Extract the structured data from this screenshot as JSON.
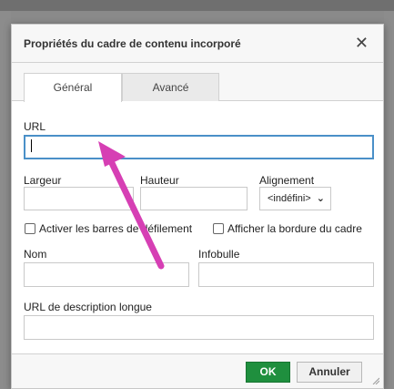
{
  "dialog": {
    "title": "Propriétés du cadre de contenu incorporé",
    "close_glyph": "✕"
  },
  "tabs": [
    {
      "label": "Général",
      "active": true
    },
    {
      "label": "Avancé",
      "active": false
    }
  ],
  "fields": {
    "url_label": "URL",
    "url_value": "",
    "width_label": "Largeur",
    "height_label": "Hauteur",
    "align_label": "Alignement",
    "align_selected": "<indéfini>",
    "scrollbars_label": "Activer les barres de défilement",
    "border_label": "Afficher la bordure du cadre",
    "name_label": "Nom",
    "tooltip_label": "Infobulle",
    "longdesc_label": "URL de description longue"
  },
  "footer": {
    "ok_label": "OK",
    "cancel_label": "Annuler"
  },
  "colors": {
    "ok_button": "#1f8f3e",
    "focus_border": "#4a90c8",
    "annotation_arrow": "#d63fb4"
  },
  "icons": {
    "close": "close-icon",
    "dropdown": "chevron-down-icon",
    "arrow": "annotation-arrow"
  }
}
